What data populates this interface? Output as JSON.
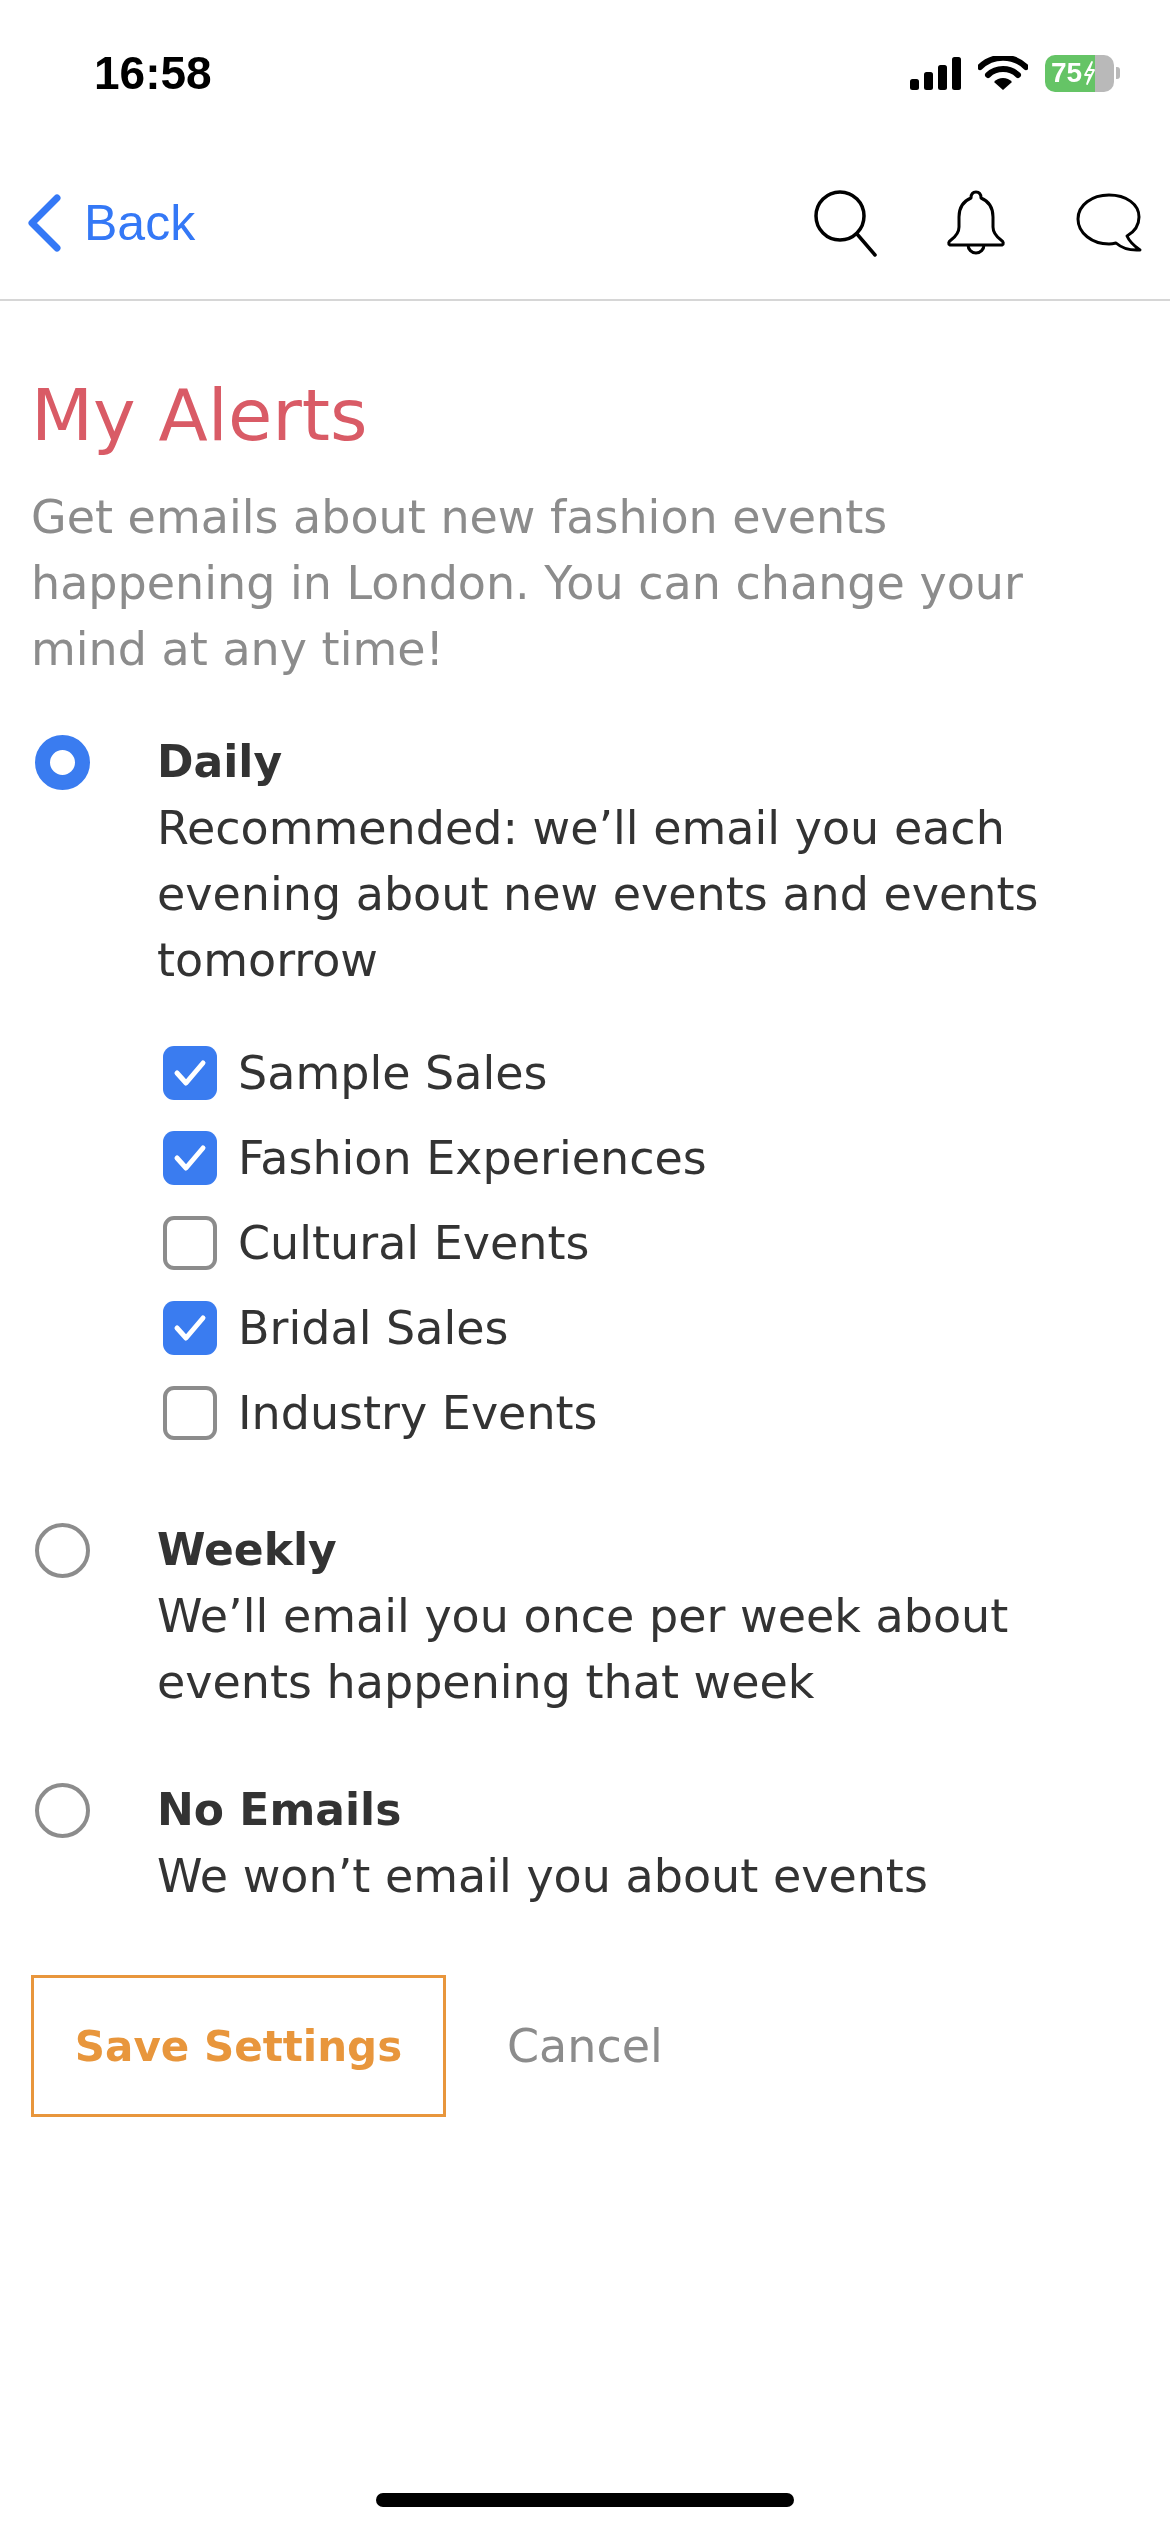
{
  "status_bar": {
    "time": "16:58",
    "battery": "75"
  },
  "nav": {
    "back": "Back"
  },
  "page": {
    "title": "My Alerts",
    "intro": "Get emails about new fashion events happening in London. You can change your mind at any time!"
  },
  "frequency_options": [
    {
      "label": "Daily",
      "description": "Recommended: we’ll email you each evening about new events and events tomorrow",
      "selected": true,
      "categories": [
        {
          "label": "Sample Sales",
          "checked": true
        },
        {
          "label": "Fashion Experiences",
          "checked": true
        },
        {
          "label": "Cultural Events",
          "checked": false
        },
        {
          "label": "Bridal Sales",
          "checked": true
        },
        {
          "label": "Industry Events",
          "checked": false
        }
      ]
    },
    {
      "label": "Weekly",
      "description": "We’ll email you once per week about events happening that week",
      "selected": false
    },
    {
      "label": "No Emails",
      "description": "We won’t email you about events",
      "selected": false
    }
  ],
  "actions": {
    "save": "Save Settings",
    "cancel": "Cancel"
  }
}
